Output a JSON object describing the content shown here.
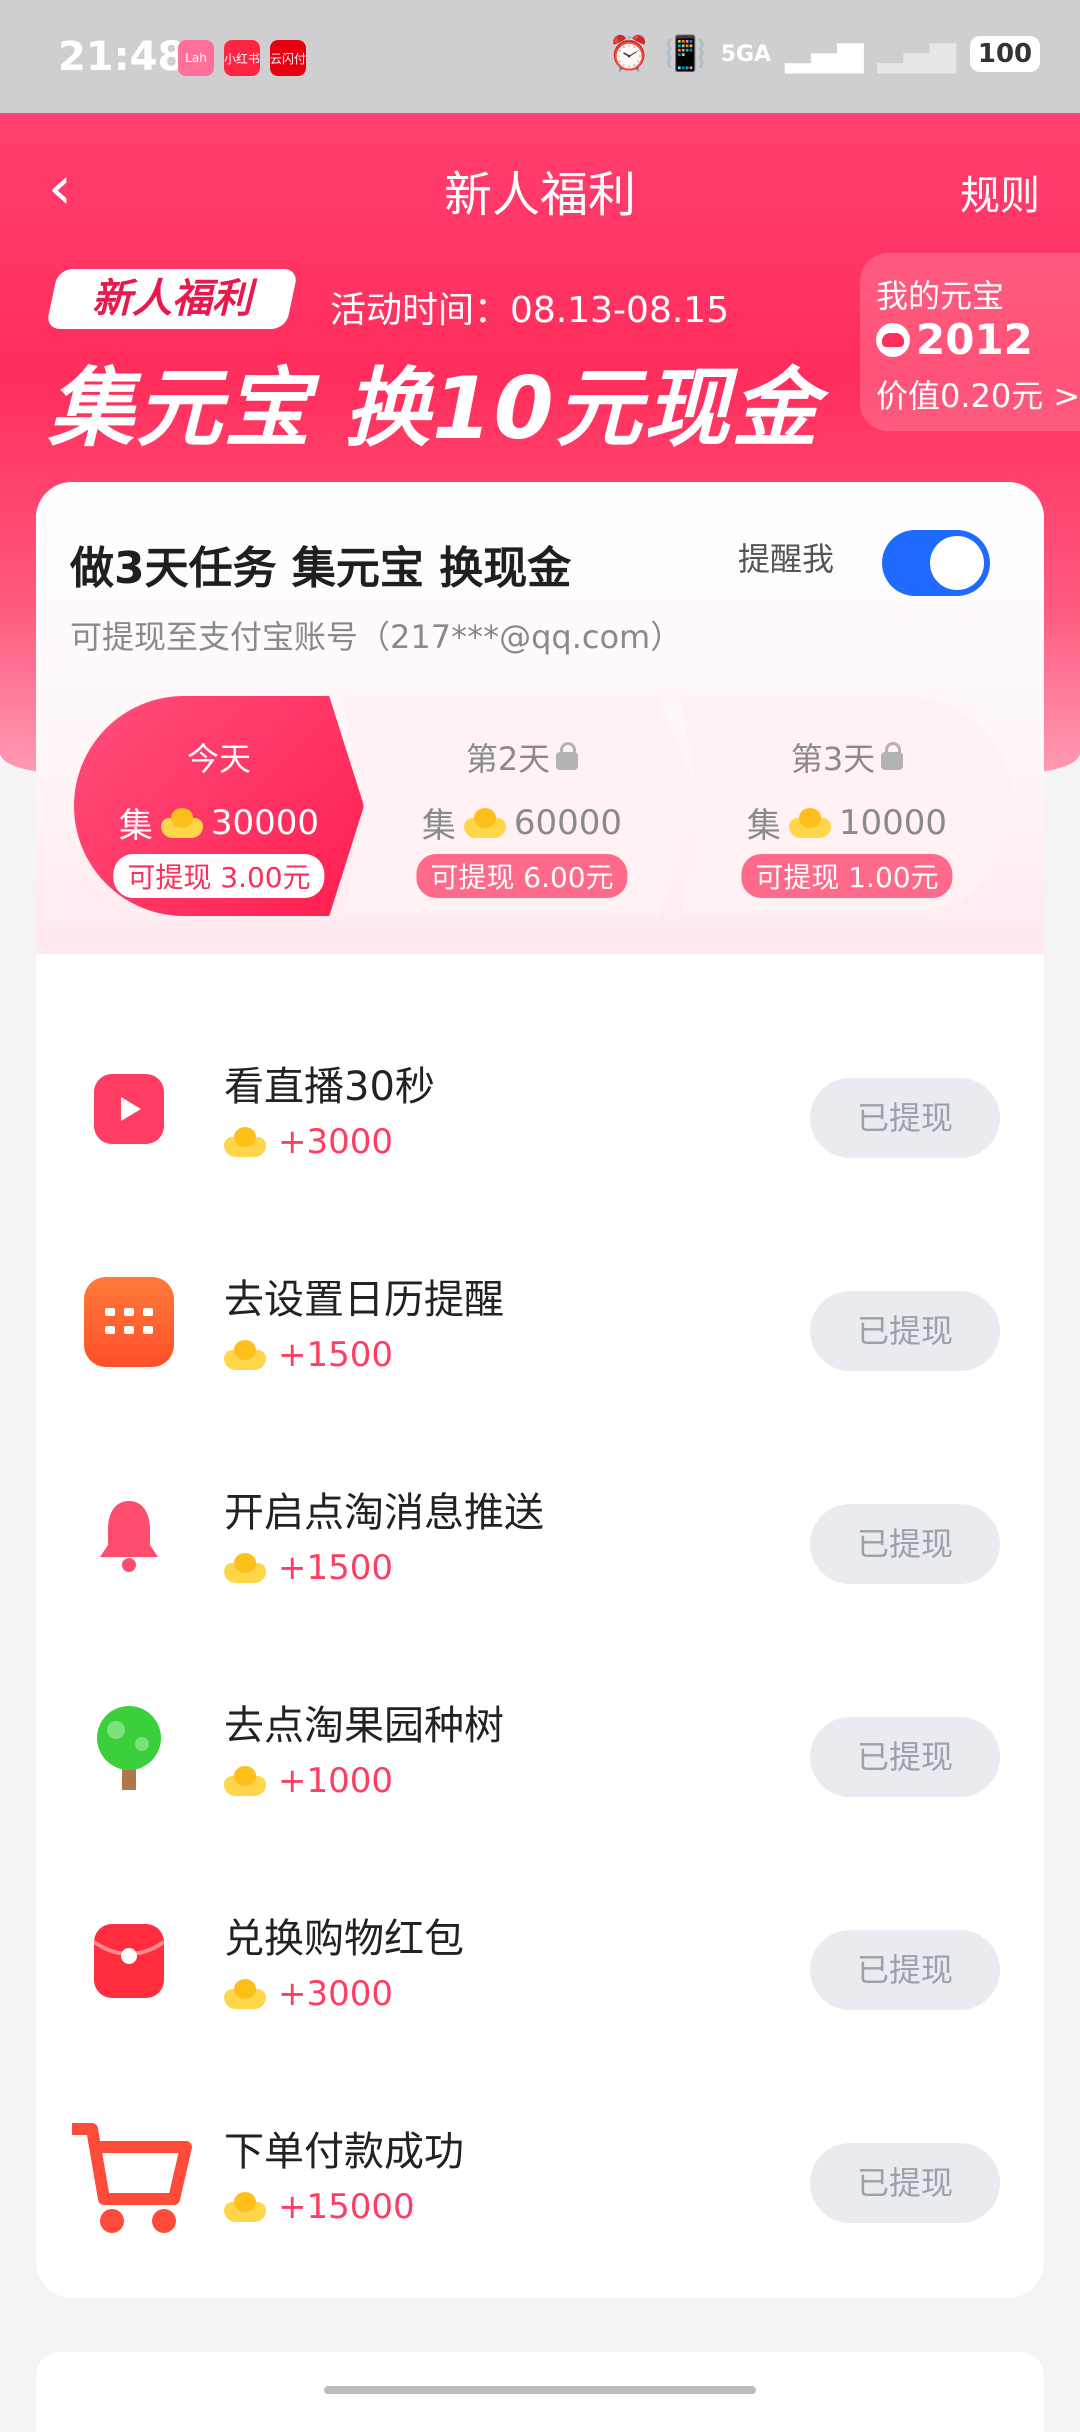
{
  "status_bar": {
    "time": "21:48",
    "apps": [
      "Lah",
      "小红书",
      "云闪付"
    ],
    "network": "5GA",
    "battery": "100"
  },
  "header": {
    "title": "新人福利",
    "rules_label": "规则"
  },
  "banner": {
    "tag": "新人福利",
    "time_label": "活动时间：08.13-08.15",
    "headline": "集元宝 换10元现金",
    "wallet": {
      "title": "我的元宝",
      "amount": "2012",
      "value": "价值0.20元 >"
    }
  },
  "card": {
    "title": "做3天任务 集元宝 换现金",
    "remind_label": "提醒我",
    "remind_on": true,
    "subtitle": "可提现至支付宝账号（217***@qq.com）",
    "days": [
      {
        "name": "今天",
        "collect_label": "集",
        "coins": "30000",
        "cash": "可提现 3.00元",
        "locked": false
      },
      {
        "name": "第2天",
        "collect_label": "集",
        "coins": "60000",
        "cash": "可提现 6.00元",
        "locked": true
      },
      {
        "name": "第3天",
        "collect_label": "集",
        "coins": "10000",
        "cash": "可提现 1.00元",
        "locked": true
      }
    ],
    "tasks": [
      {
        "name": "看直播30秒",
        "reward": "+3000",
        "button": "已提现",
        "icon": "play-icon"
      },
      {
        "name": "去设置日历提醒",
        "reward": "+1500",
        "button": "已提现",
        "icon": "calendar-icon"
      },
      {
        "name": "开启点淘消息推送",
        "reward": "+1500",
        "button": "已提现",
        "icon": "bell-icon"
      },
      {
        "name": "去点淘果园种树",
        "reward": "+1000",
        "button": "已提现",
        "icon": "tree-icon"
      },
      {
        "name": "兑换购物红包",
        "reward": "+3000",
        "button": "已提现",
        "icon": "red-envelope-icon"
      },
      {
        "name": "下单付款成功",
        "reward": "+15000",
        "button": "已提现",
        "icon": "cart-icon"
      }
    ]
  },
  "colors": {
    "accent": "#ff2d5b",
    "toggle": "#1f6bff",
    "reward": "#ff3d62"
  }
}
